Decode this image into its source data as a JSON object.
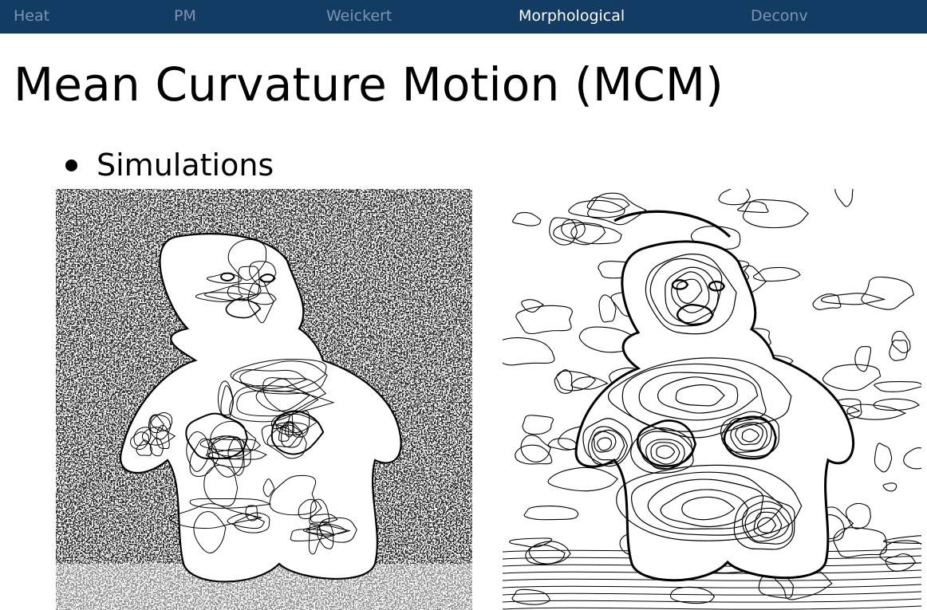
{
  "nav": {
    "items": [
      {
        "label": "Heat",
        "active": false
      },
      {
        "label": "PM",
        "active": false
      },
      {
        "label": "Weickert",
        "active": false
      },
      {
        "label": "Morphological",
        "active": true
      },
      {
        "label": "Deconv",
        "active": false
      }
    ],
    "bar_color": "#123c64",
    "inactive_color": "#7f95ad",
    "active_color": "#ffffff"
  },
  "slide": {
    "title": "Mean Curvature Motion (MCM)",
    "bullet": "Simulations"
  },
  "figures": [
    {
      "name": "noisy-contour-image",
      "content": "dense level-line contours of a baby figurine with heavy noise"
    },
    {
      "name": "mcm-smoothed-contour-image",
      "content": "smooth level-line contours of a baby figurine after mean curvature motion"
    }
  ]
}
